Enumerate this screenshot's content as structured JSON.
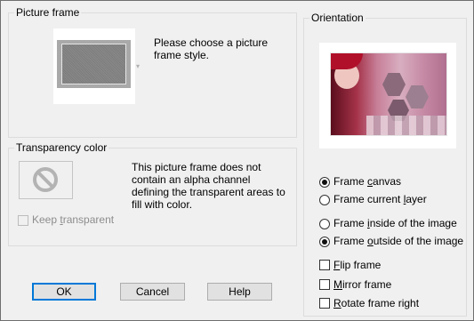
{
  "picture_frame": {
    "group_title": "Picture frame",
    "prompt_line1": "Please choose a picture",
    "prompt_line2": "frame style."
  },
  "transparency": {
    "group_title": "Transparency color",
    "info_line1": "This picture frame does not",
    "info_line2": "contain an alpha channel",
    "info_line3": "defining the transparent areas to",
    "info_line4": "fill with color.",
    "keep_transparent": {
      "pre": "Keep ",
      "accel": "t",
      "post": "ransparent",
      "checked": false,
      "enabled": false
    }
  },
  "orientation": {
    "group_title": "Orientation",
    "frame_canvas": {
      "pre": "Frame ",
      "accel": "c",
      "post": "anvas",
      "selected": true
    },
    "frame_current_layer": {
      "pre": "Frame current ",
      "accel": "l",
      "post": "ayer",
      "selected": false
    },
    "frame_inside": {
      "pre": "Frame ",
      "accel": "i",
      "post": "nside of the image",
      "selected": false
    },
    "frame_outside": {
      "pre": "Frame ",
      "accel": "o",
      "post": "utside of the image",
      "selected": true
    },
    "flip_frame": {
      "pre": "",
      "accel": "F",
      "post": "lip frame",
      "checked": false
    },
    "mirror_frame": {
      "pre": "",
      "accel": "M",
      "post": "irror frame",
      "checked": false
    },
    "rotate_frame_right": {
      "pre": "",
      "accel": "R",
      "post": "otate frame right",
      "checked": false
    }
  },
  "buttons": {
    "ok": "OK",
    "cancel": "Cancel",
    "help": "Help"
  },
  "colors": {
    "dialog_bg": "#f0f0f0",
    "default_button_border": "#0078d7",
    "frame_gray": "#a9a9a9"
  }
}
